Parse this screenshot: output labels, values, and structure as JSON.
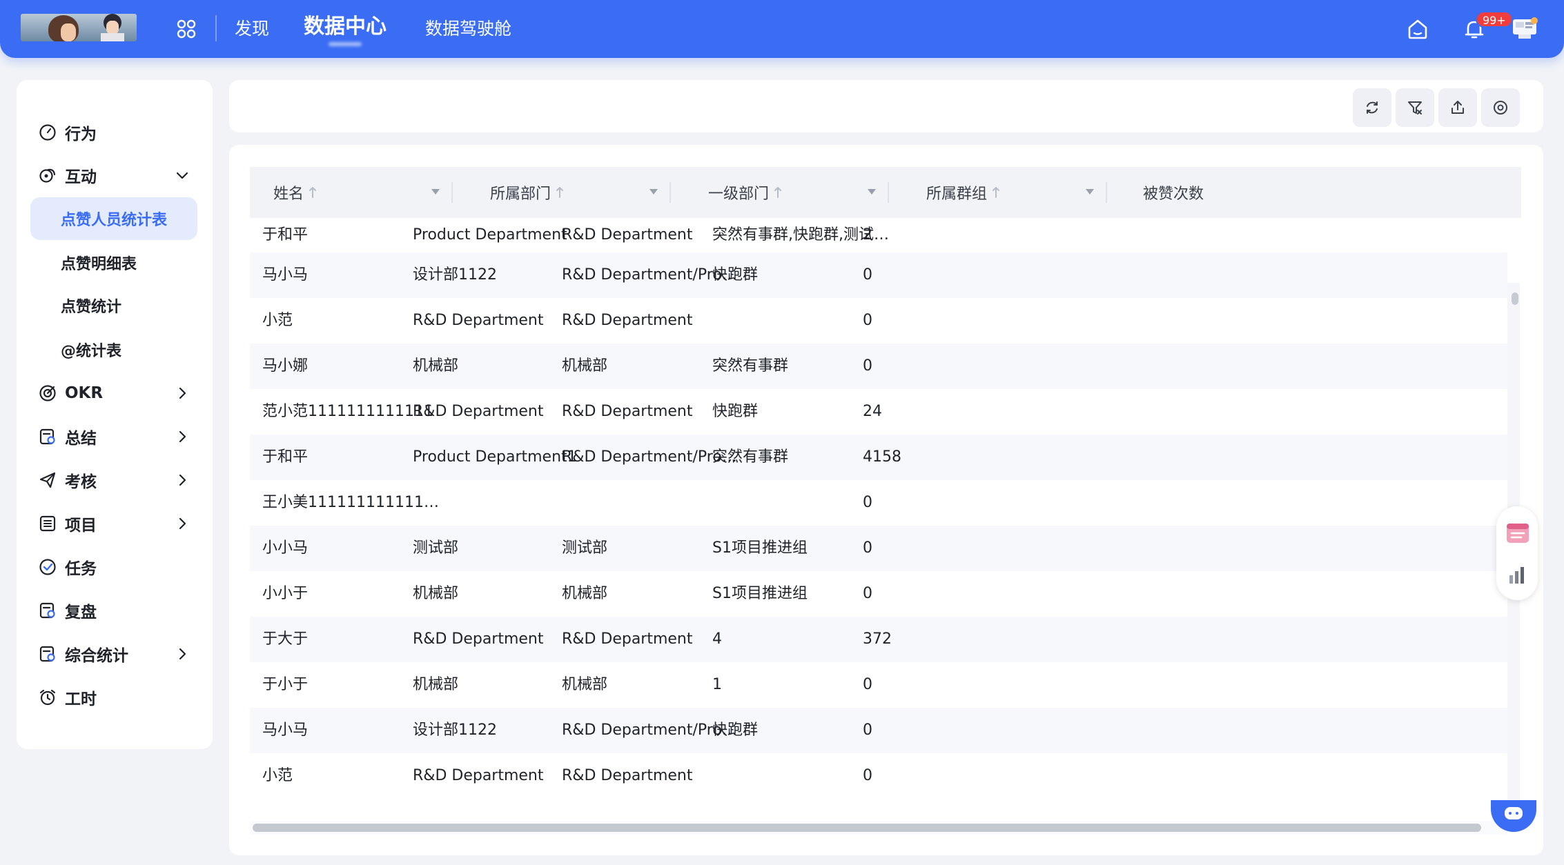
{
  "nav": {
    "items": [
      "发现",
      "数据中心",
      "数据驾驶舱"
    ],
    "active": "数据中心",
    "notification_badge": "99+"
  },
  "sidebar": {
    "items": [
      {
        "label": "行为",
        "icon": "gauge-icon",
        "expandable": false
      },
      {
        "label": "互动",
        "icon": "interaction-icon",
        "expandable": true,
        "expanded": true
      },
      {
        "label": "OKR",
        "icon": "target-icon",
        "expandable": true
      },
      {
        "label": "总结",
        "icon": "summary-icon",
        "expandable": true
      },
      {
        "label": "考核",
        "icon": "send-icon",
        "expandable": true
      },
      {
        "label": "项目",
        "icon": "list-icon",
        "expandable": true
      },
      {
        "label": "任务",
        "icon": "check-circle-icon",
        "expandable": false
      },
      {
        "label": "复盘",
        "icon": "review-icon",
        "expandable": false
      },
      {
        "label": "综合统计",
        "icon": "stats-icon",
        "expandable": true
      },
      {
        "label": "工时",
        "icon": "alarm-clock-icon",
        "expandable": false
      }
    ],
    "subitems": [
      "点赞人员统计表",
      "点赞明细表",
      "点赞统计",
      "@统计表"
    ],
    "active_subitem": "点赞人员统计表"
  },
  "toolbar": {
    "icons": [
      "refresh-icon",
      "filter-clear-icon",
      "export-icon",
      "settings-icon"
    ]
  },
  "table": {
    "columns": [
      "姓名",
      "所属部门",
      "一级部门",
      "所属群组",
      "被赞次数"
    ],
    "rows": [
      [
        "于和平",
        "Product Department",
        "R&D Department",
        "突然有事群,快跑群,测试,...",
        "2"
      ],
      [
        "马小马",
        "设计部1122",
        "R&D Department/Produ...",
        "快跑群",
        "0"
      ],
      [
        "小范",
        "R&D Department",
        "R&D Department",
        "",
        "0"
      ],
      [
        "马小娜",
        "机械部",
        "机械部",
        "突然有事群",
        "0"
      ],
      [
        "范小范1111111111111",
        "R&D Department",
        "R&D Department",
        "快跑群",
        "24"
      ],
      [
        "于和平",
        "Product Department1",
        "R&D Department/Produ...",
        "突然有事群",
        "4158"
      ],
      [
        "王小美1111111111111111...",
        "",
        "",
        "",
        "0"
      ],
      [
        "小小马",
        "测试部",
        "测试部",
        "S1项目推进组",
        "0"
      ],
      [
        "小小于",
        "机械部",
        "机械部",
        "S1项目推进组",
        "0"
      ],
      [
        "于大于",
        "R&D Department",
        "R&D Department",
        "4",
        "372"
      ],
      [
        "于小于",
        "机械部",
        "机械部",
        "1",
        "0"
      ],
      [
        "马小马",
        "设计部1122",
        "R&D Department/Produ...",
        "快跑群",
        "0"
      ],
      [
        "小范",
        "R&D Department",
        "R&D Department",
        "",
        "0"
      ]
    ]
  },
  "colors": {
    "brand": "#3a6cf4",
    "active_bg": "#e3ebfc",
    "badge": "#f23d3d"
  }
}
